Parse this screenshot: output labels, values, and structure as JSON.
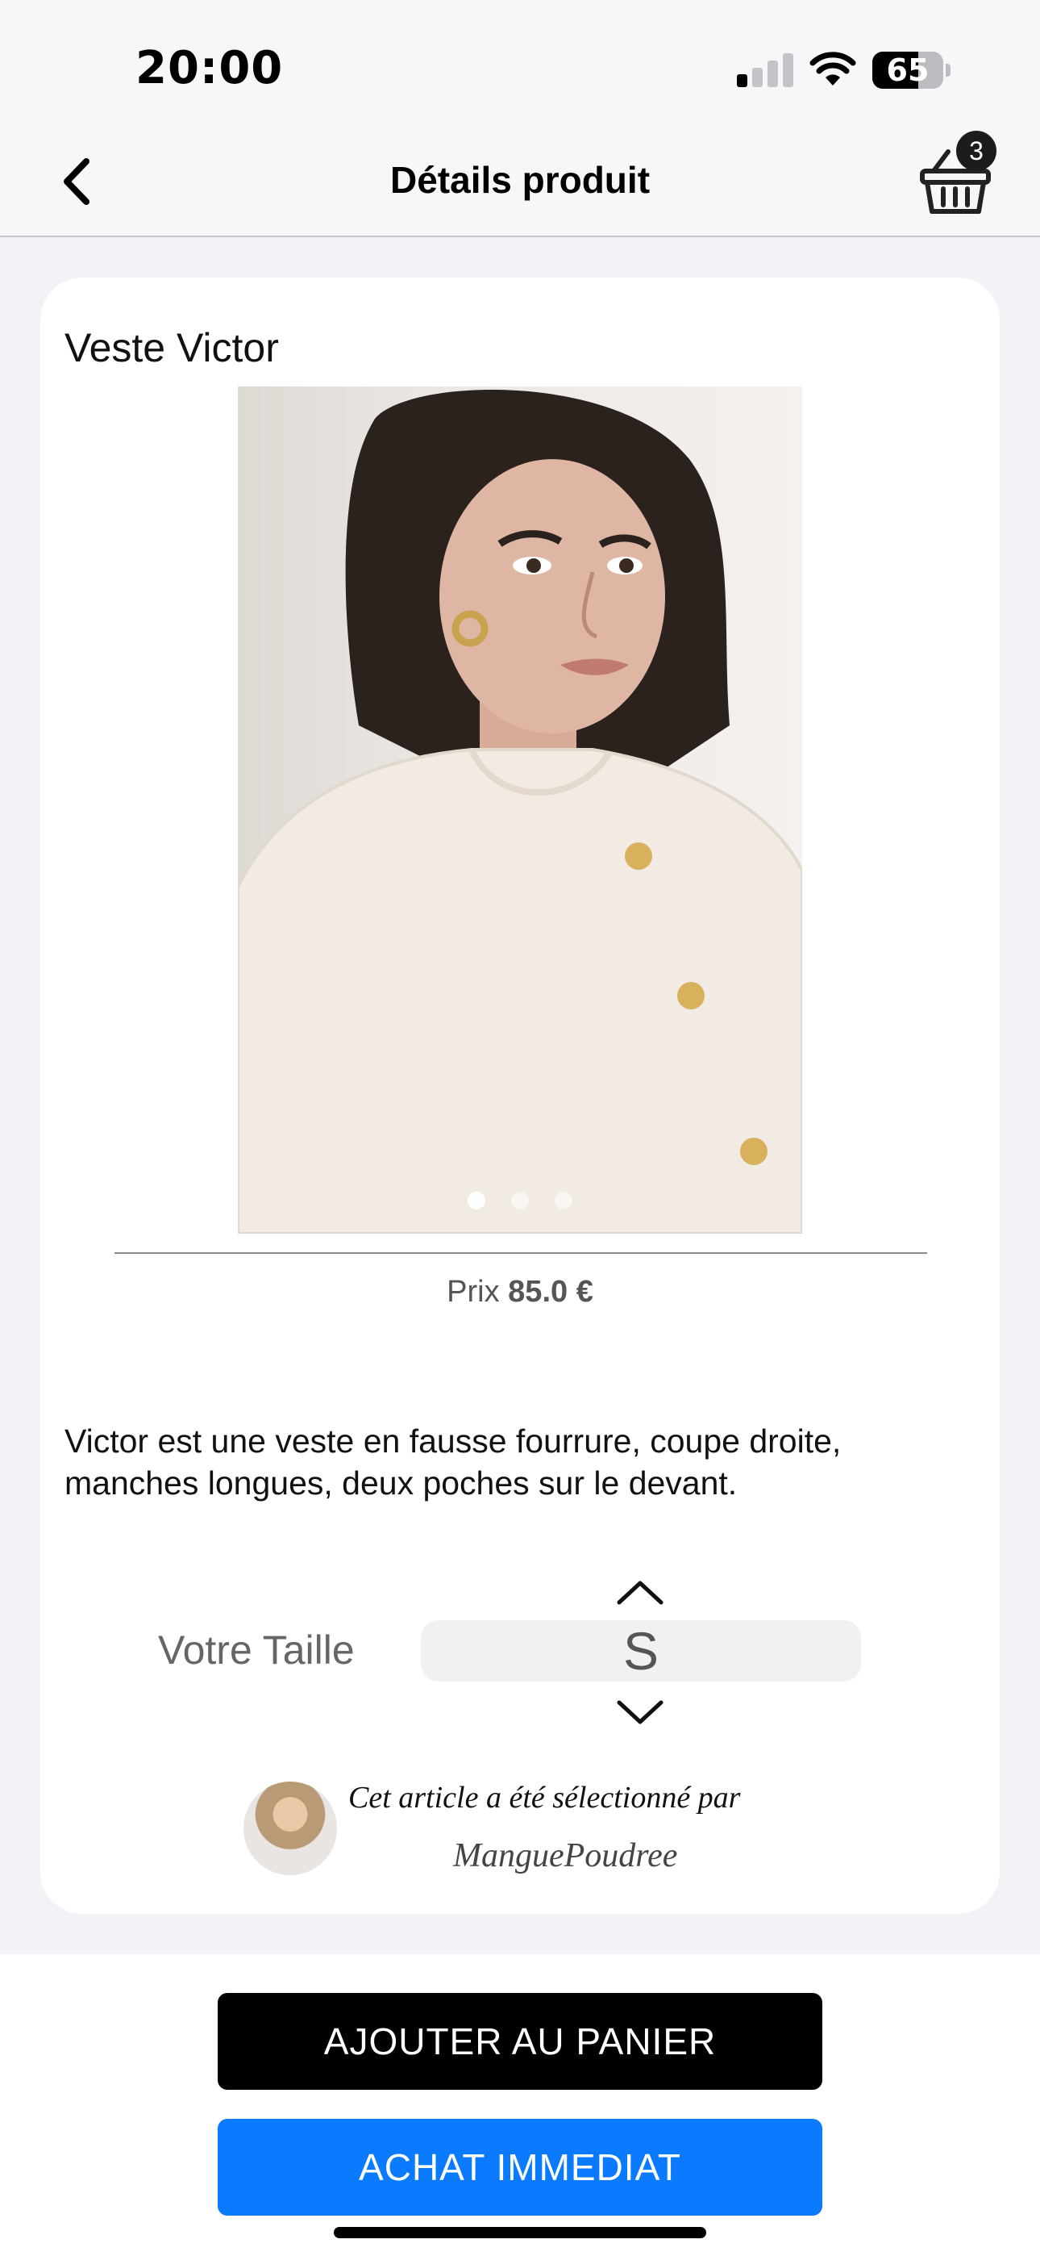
{
  "status_bar": {
    "time": "20:00",
    "battery": "65",
    "battery_level": 0.65,
    "signal_bars_active": 1,
    "signal_bars_total": 4
  },
  "nav": {
    "title": "Détails produit",
    "back_icon": "chevron-left-icon",
    "cart_icon": "basket-icon",
    "cart_count": "3"
  },
  "product": {
    "name": "Veste Victor",
    "image_count": 3,
    "active_image": 1,
    "price_label": "Prix",
    "price_value": "85.0 €",
    "description": "Victor est une veste en fausse fourrure, coupe droite, manches longues, deux poches sur le devant."
  },
  "size": {
    "label": "Votre Taille",
    "value": "S"
  },
  "curator": {
    "text": "Cet article a été sélectionné par",
    "name": "ManguePoudree"
  },
  "actions": {
    "add_to_cart": "AJOUTER AU PANIER",
    "buy_now": "ACHAT IMMEDIAT"
  },
  "colors": {
    "buy_button": "#0a7aff",
    "cart_button": "#000000"
  }
}
